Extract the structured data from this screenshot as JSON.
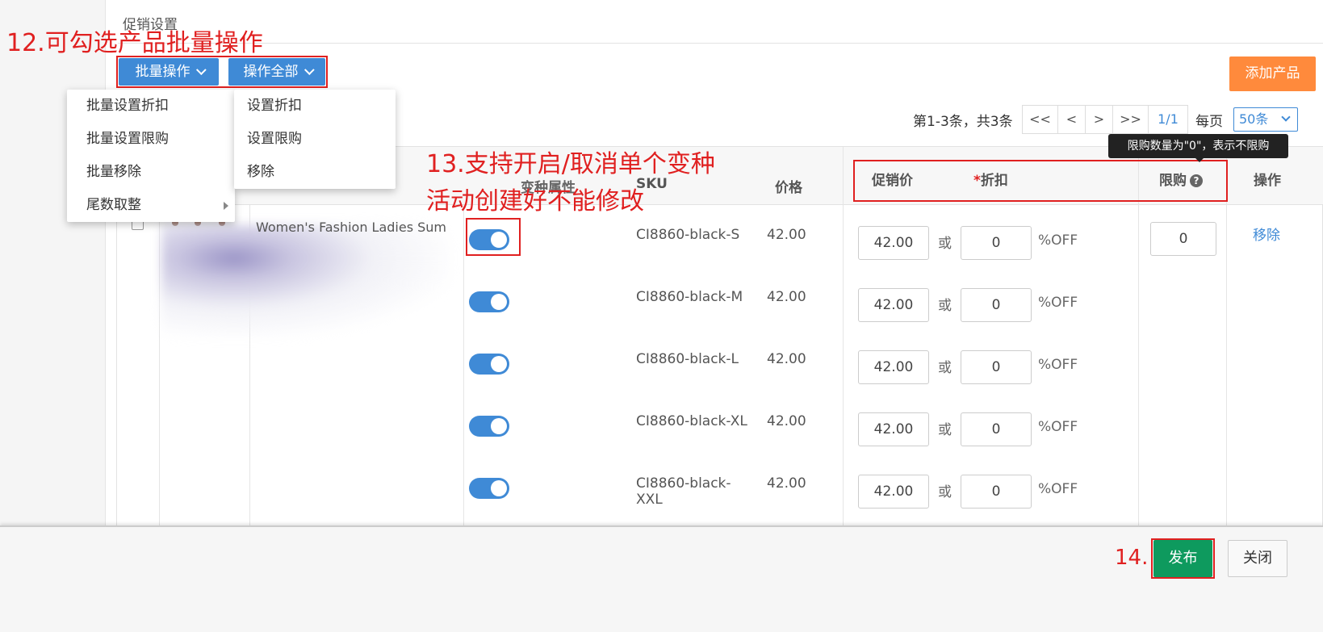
{
  "section": {
    "title": "促销设置"
  },
  "annotations": {
    "a12": "12.可勾选产品批量操作",
    "a13_line1": "13.支持开启/取消单个变种",
    "a13_line2": "活动创建好不能修改",
    "a14": "14."
  },
  "toolbar": {
    "batch_label": "批量操作",
    "all_label": "操作全部",
    "add_product": "添加产品"
  },
  "batch_menu": [
    {
      "label": "批量设置折扣"
    },
    {
      "label": "批量设置限购"
    },
    {
      "label": "批量移除"
    },
    {
      "label": "尾数取整"
    }
  ],
  "all_menu": [
    {
      "label": "设置折扣"
    },
    {
      "label": "设置限购"
    },
    {
      "label": "移除"
    }
  ],
  "pagination": {
    "info": "第1-3条，共3条",
    "first": "<<",
    "prev": "<",
    "next": ">",
    "last": ">>",
    "current": "1/1",
    "per_page_label": "每页",
    "per_page_value": "50条"
  },
  "tooltip": "限购数量为\"0\"，表示不限购",
  "table": {
    "headers": {
      "variant": "变种属性",
      "sku": "SKU",
      "price": "价格",
      "promo_price": "促销价",
      "discount_star": "*",
      "discount": "折扣",
      "limit": "限购",
      "limit_help": "?",
      "action": "操作"
    },
    "product_name": "Women's Fashion Ladies Sum",
    "or_label": "或",
    "off_label": "%OFF",
    "limit_value": "0",
    "remove_label": "移除",
    "rows": [
      {
        "sku": "CI8860-black-S",
        "price": "42.00",
        "promo": "42.00",
        "discount": "0"
      },
      {
        "sku": "CI8860-black-M",
        "price": "42.00",
        "promo": "42.00",
        "discount": "0"
      },
      {
        "sku": "CI8860-black-L",
        "price": "42.00",
        "promo": "42.00",
        "discount": "0"
      },
      {
        "sku": "CI8860-black-XL",
        "price": "42.00",
        "promo": "42.00",
        "discount": "0"
      },
      {
        "sku": "CI8860-black-XXL",
        "price": "42.00",
        "promo": "42.00",
        "discount": "0"
      }
    ]
  },
  "footer": {
    "publish": "发布",
    "close": "关闭"
  },
  "colors": {
    "primary": "#3f8ad6",
    "orange": "#ff8a3c",
    "green": "#0e9a5e",
    "annotation_red": "#e02020"
  }
}
